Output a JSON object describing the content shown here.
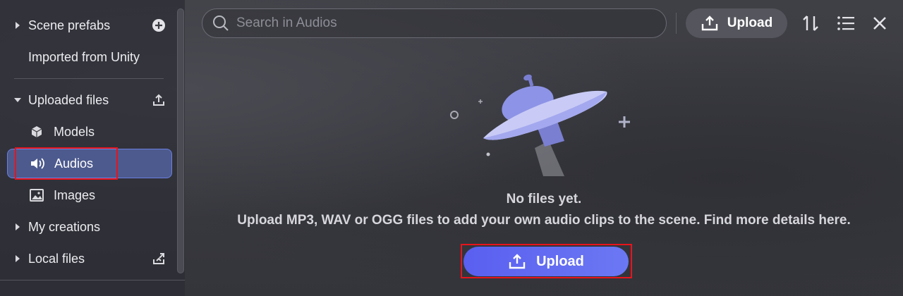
{
  "sidebar": {
    "scene_prefabs": "Scene prefabs",
    "imported_from_unity": "Imported from Unity",
    "uploaded_files": "Uploaded files",
    "models": "Models",
    "audios": "Audios",
    "images": "Images",
    "my_creations": "My creations",
    "local_files": "Local files"
  },
  "search": {
    "placeholder": "Search in Audios"
  },
  "toolbar": {
    "upload_label": "Upload"
  },
  "empty_state": {
    "title": "No files yet.",
    "description": "Upload MP3,  WAV or OGG files to add your own audio clips to the scene. Find more details here.",
    "upload_label": "Upload"
  },
  "colors": {
    "accent": "#5b60f0",
    "active_item": "#4d5a8e",
    "highlight_box": "#e8141c"
  },
  "icons": [
    "plus-circle-icon",
    "upload-icon",
    "cube-icon",
    "speaker-icon",
    "image-icon",
    "local-upload-icon",
    "search-icon",
    "sort-icon",
    "list-icon",
    "close-icon",
    "ufo-illustration"
  ]
}
